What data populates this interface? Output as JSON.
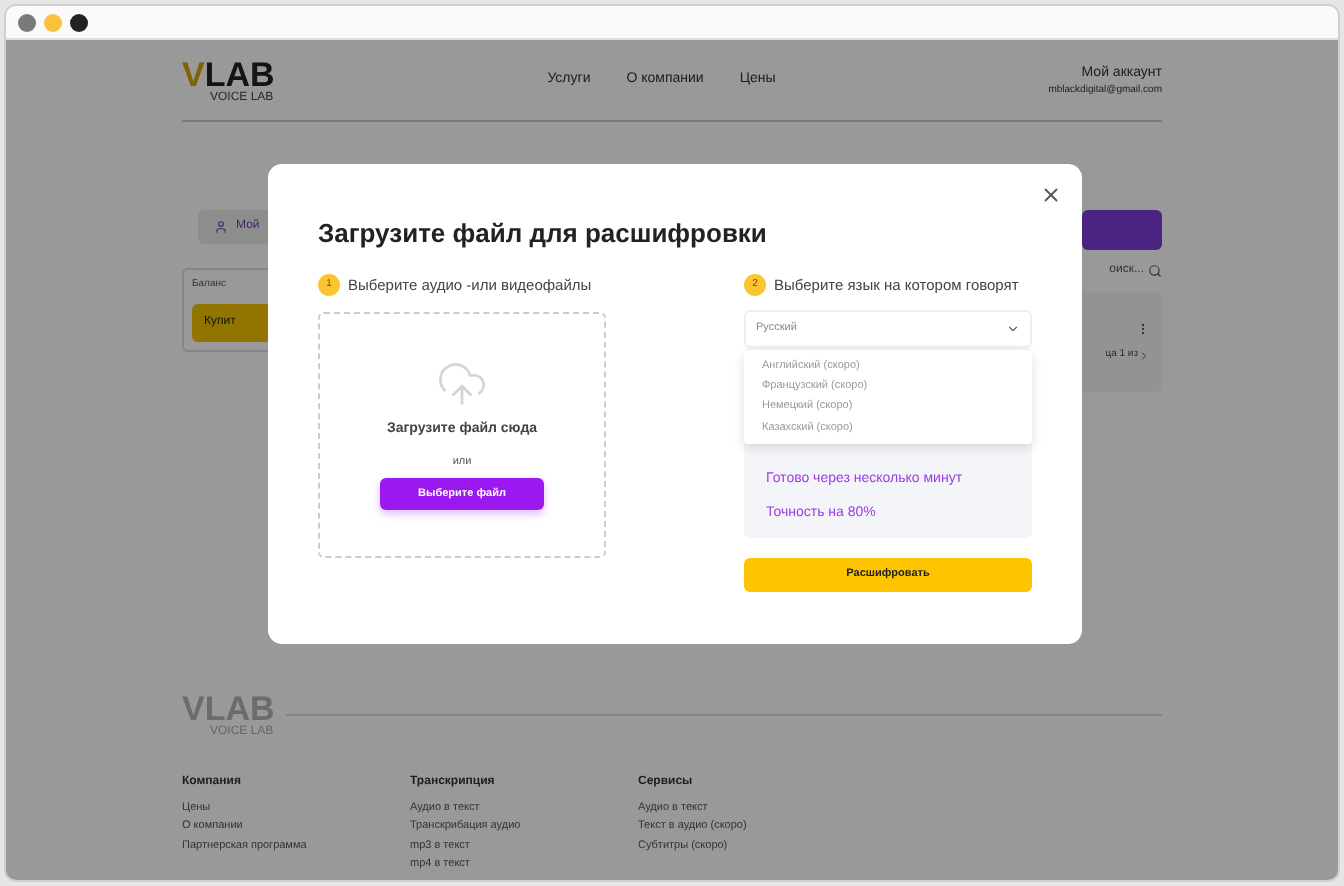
{
  "header": {
    "logo": "VLAB",
    "logo_sub": "VOICE LAB",
    "nav": [
      "Услуги",
      "О компании",
      "Цены"
    ],
    "account_title": "Мой аккаунт",
    "account_email": "mblackdigital@gmail.com"
  },
  "background": {
    "profile_tab": "Мой",
    "balance_label": "Баланс",
    "buy_button": "Купит",
    "search_placeholder": "оиск...",
    "pager": "ца 1 из"
  },
  "modal": {
    "title": "Загрузите файл для расшифровки",
    "steps": [
      {
        "number": "1",
        "label": "Выберите аудио -или видеофайлы"
      },
      {
        "number": "2",
        "label": "Выберите язык на котором говорят"
      }
    ],
    "upload": {
      "prompt": "Загрузите файл сюда",
      "or": "или",
      "button": "Выберите файл"
    },
    "language": {
      "value": "Русский",
      "expanded": true,
      "options": [
        "Английский (скоро)",
        "Французский (скоро)",
        "Немецкий (скоро)",
        "Казахский (скоро)"
      ]
    },
    "info": [
      "Готово через несколько минут",
      "Точность на 80%"
    ],
    "submit": "Расшифровать"
  },
  "footer": {
    "logo": "VLAB",
    "logo_sub": "VOICE LAB",
    "columns": [
      {
        "title": "Компания",
        "links": [
          "Цены",
          "О компании",
          "Партнерская программа"
        ]
      },
      {
        "title": "Транскрипция",
        "links": [
          "Аудио в текст",
          "Транскрибация аудио",
          "mp3 в текст",
          "mp4 в текст"
        ]
      },
      {
        "title": "Сервисы",
        "links": [
          "Аудио в текст",
          "Текст в аудио (скоро)",
          "Субтитры (скоро)"
        ]
      }
    ]
  }
}
